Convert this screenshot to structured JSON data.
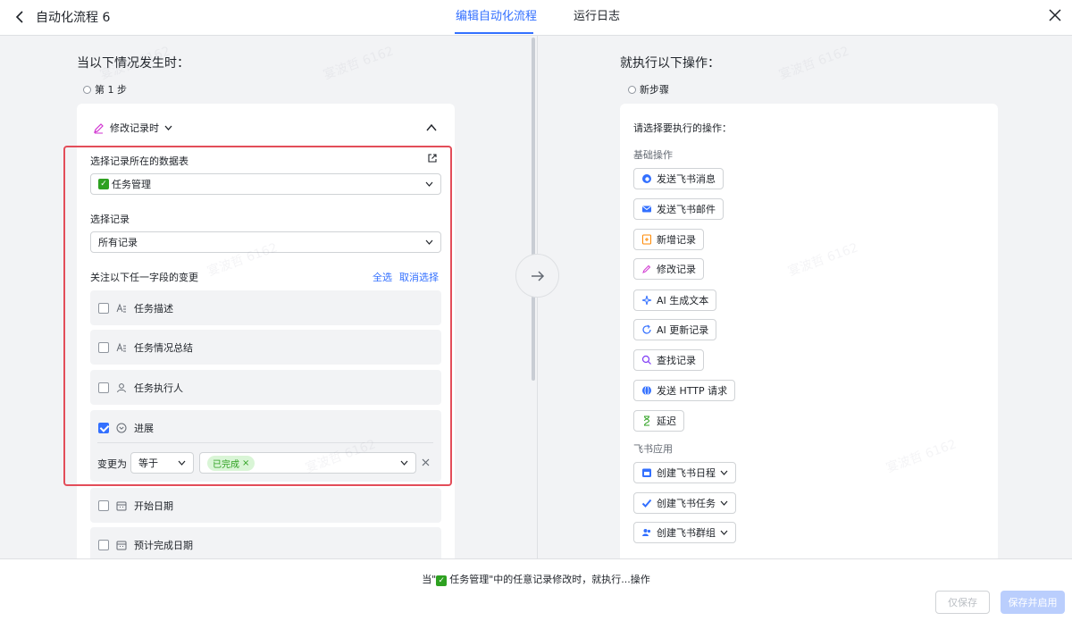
{
  "header": {
    "title": "自动化流程 6",
    "tabs": [
      {
        "label": "编辑自动化流程",
        "active": true
      },
      {
        "label": "运行日志",
        "active": false
      }
    ]
  },
  "left": {
    "section_title": "当以下情况发生时：",
    "step_label": "第 1 步",
    "trigger": "修改记录时",
    "table_label": "选择记录所在的数据表",
    "table_value": "任务管理",
    "record_label": "选择记录",
    "record_value": "所有记录",
    "fields_label": "关注以下任一字段的变更",
    "select_all": "全选",
    "deselect": "取消选择",
    "fields": [
      {
        "label": "任务描述",
        "icon": "text-field-icon",
        "checked": false
      },
      {
        "label": "任务情况总结",
        "icon": "text-field-icon",
        "checked": false
      },
      {
        "label": "任务执行人",
        "icon": "person-icon",
        "checked": false
      },
      {
        "label": "进展",
        "icon": "single-select-icon",
        "checked": true
      },
      {
        "label": "开始日期",
        "icon": "calendar-icon",
        "checked": false
      },
      {
        "label": "预计完成日期",
        "icon": "calendar-icon",
        "checked": false
      }
    ],
    "condition": {
      "prefix": "变更为",
      "operator": "等于",
      "tag": "已完成"
    }
  },
  "right": {
    "section_title": "就执行以下操作：",
    "step_label": "新步骤",
    "prompt": "请选择要执行的操作：",
    "group_basic": "基础操作",
    "basic_actions": [
      {
        "label": "发送飞书消息",
        "icon": "message-icon",
        "color": "#3370ff"
      },
      {
        "label": "发送飞书邮件",
        "icon": "mail-icon",
        "color": "#3370ff"
      },
      {
        "label": "新增记录",
        "icon": "add-record-icon",
        "color": "#ff8800"
      },
      {
        "label": "修改记录",
        "icon": "edit-icon",
        "color": "#d136d1"
      },
      {
        "label": "AI 生成文本",
        "icon": "ai-sparkle-icon",
        "color": "#3370ff"
      },
      {
        "label": "AI 更新记录",
        "icon": "refresh-icon",
        "color": "#3370ff"
      },
      {
        "label": "查找记录",
        "icon": "search-icon",
        "color": "#7f3bf5"
      },
      {
        "label": "发送 HTTP 请求",
        "icon": "globe-icon",
        "color": "#3370ff"
      },
      {
        "label": "延迟",
        "icon": "hourglass-icon",
        "color": "#2ea121"
      }
    ],
    "group_apps": "飞书应用",
    "app_actions": [
      {
        "label": "创建飞书日程",
        "icon": "calendar-app-icon",
        "color": "#3370ff"
      },
      {
        "label": "创建飞书任务",
        "icon": "task-check-icon",
        "color": "#3370ff"
      },
      {
        "label": "创建飞书群组",
        "icon": "group-icon",
        "color": "#3370ff"
      }
    ]
  },
  "footer": {
    "summary_pre": "当\"",
    "summary_table": "任务管理",
    "summary_post": "\"中的任意记录修改时，就执行...操作",
    "save": "仅保存",
    "save_enable": "保存并启用"
  },
  "watermark": "宴波哲 6162"
}
